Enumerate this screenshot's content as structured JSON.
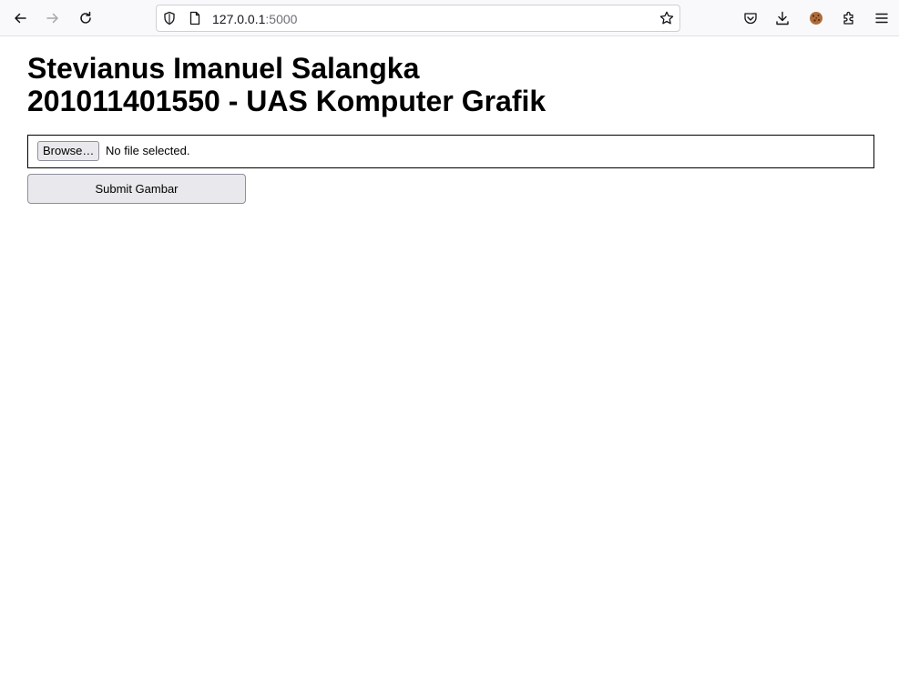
{
  "browser": {
    "url_host": "127.0.0.1",
    "url_port": ":5000",
    "icons": {
      "back": "arrow-left-icon",
      "forward": "arrow-right-icon",
      "reload": "reload-icon",
      "site_info": "shield-icon",
      "page": "page-icon",
      "bookmark": "star-icon",
      "pocket": "pocket-icon",
      "downloads": "download-icon",
      "cookie": "cookie-icon",
      "extensions": "puzzle-icon",
      "menu": "hamburger-menu-icon"
    }
  },
  "page": {
    "title_line1": "Stevianus Imanuel Salangka",
    "title_line2": "201011401550 - UAS Komputer Grafik",
    "file_input": {
      "button_label": "Browse…",
      "status_text": "No file selected."
    },
    "submit_label": "Submit Gambar"
  },
  "colors": {
    "toolbar_bg": "#f9f9fb",
    "button_bg": "#e9e9ed",
    "button_border": "#8f8f9d",
    "text": "#000000"
  }
}
